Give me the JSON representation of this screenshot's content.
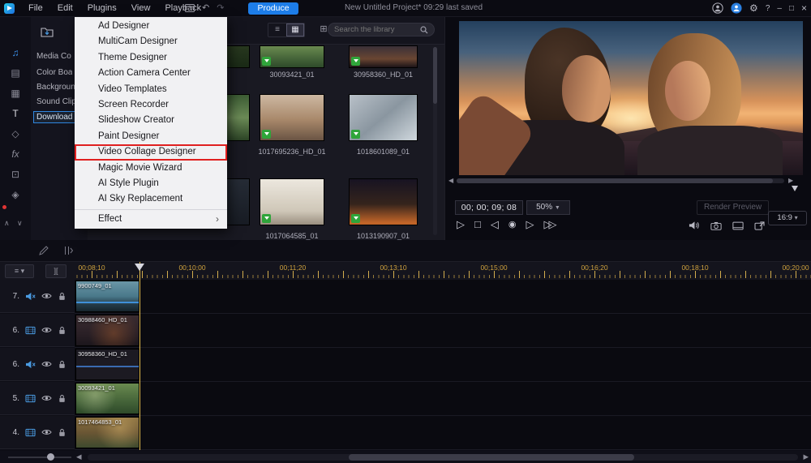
{
  "icons": {
    "undo": "↶",
    "redo": "↷",
    "help": "?",
    "min": "–",
    "max": "□",
    "close": "×",
    "list_view": "≡",
    "grid_view": "▦",
    "explorer_view": "⊞",
    "chevron_right": "›",
    "caret": "▾",
    "caret_down": "▼",
    "play": "▷",
    "stop": "□",
    "prev_frame": "◁",
    "record": "◉",
    "next_frame": "▷",
    "fast_forward": "▷▷",
    "arrow_left": "◀",
    "arrow_right": "▶",
    "chevron_up": "∧",
    "chevron_down": "∨",
    "track_manager": "≡ ▾",
    "split": "][",
    "rail": [
      "♫",
      "▤",
      "▦",
      "T",
      "◇",
      "fx",
      "⊡",
      "◈"
    ]
  },
  "menubar": {
    "items": [
      "File",
      "Edit",
      "Plugins",
      "View",
      "Playback"
    ],
    "produce": "Produce",
    "title": "New Untitled Project* 09:29 last saved"
  },
  "plugins_menu": {
    "items": [
      "Ad Designer",
      "MultiCam Designer",
      "Theme Designer",
      "Action Camera Center",
      "Video Templates",
      "Screen Recorder",
      "Slideshow Creator",
      "Paint Designer",
      "Video Collage Designer",
      "Magic Movie Wizard",
      "AI Style Plugin",
      "AI Sky Replacement",
      "Effect"
    ]
  },
  "categories": [
    "Media Co",
    "Color Boa",
    "Backgroun",
    "Sound Clip",
    "Download"
  ],
  "library": {
    "search_placeholder": "Search the library",
    "items": [
      "30093421_01",
      "30958360_HD_01",
      "1017695236_HD_01",
      "1018601089_01",
      "1017064585_01",
      "1013190907_01"
    ]
  },
  "preview": {
    "timecode": "00; 00; 09; 08",
    "zoom": "50%",
    "render": "Render Preview",
    "aspect": "16:9"
  },
  "timeline": {
    "ruler": [
      "00;08;10",
      "00;10;00",
      "00;11;20",
      "00;13;10",
      "00;15;00",
      "00;16;20",
      "00;18;10",
      "00;20;00"
    ],
    "tracks": [
      {
        "num": "7.",
        "clip": "9900749_01"
      },
      {
        "num": "6.",
        "clip": "30988460_HD_01"
      },
      {
        "num": "6.",
        "clip": "30958360_HD_01"
      },
      {
        "num": "5.",
        "clip": "30093421_01"
      },
      {
        "num": "4.",
        "clip": "1017464853_01"
      }
    ]
  }
}
